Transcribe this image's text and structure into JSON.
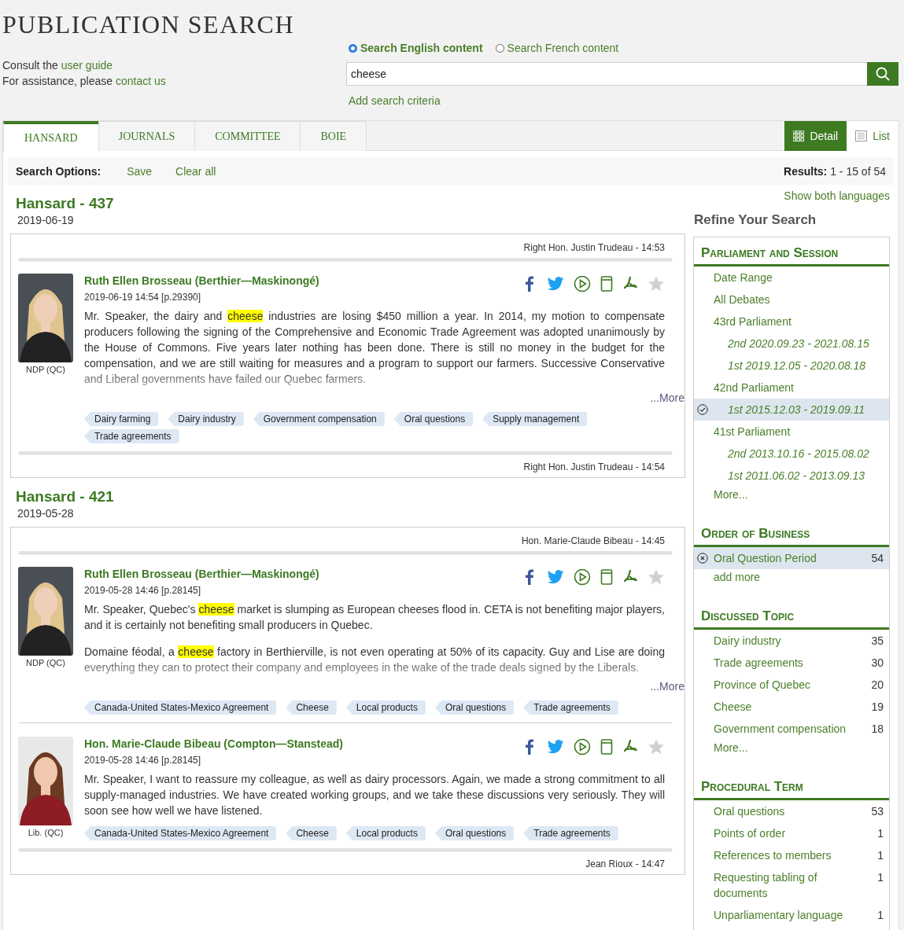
{
  "title": "PUBLICATION SEARCH",
  "help": [
    {
      "text": "Consult the ",
      "link": "user guide"
    },
    {
      "text": "For assistance, please ",
      "link": "contact us"
    }
  ],
  "language_options": [
    {
      "label": "Search English content",
      "selected": true
    },
    {
      "label": "Search French content",
      "selected": false
    }
  ],
  "search": {
    "value": "cheese"
  },
  "add_criteria": "Add search criteria",
  "tabs": [
    {
      "label": "HANSARD",
      "selected": true
    },
    {
      "label": "JOURNALS",
      "selected": false
    },
    {
      "label": "COMMITTEE",
      "selected": false
    },
    {
      "label": "BOIE",
      "selected": false
    }
  ],
  "views": [
    {
      "label": "Detail",
      "kind": "grid",
      "selected": true
    },
    {
      "label": "List",
      "kind": "list",
      "selected": false
    }
  ],
  "options_bar": {
    "label": "Search Options:",
    "actions": [
      "Save",
      "Clear all"
    ],
    "results_label": "Results:",
    "results": "1 - 15 of 54"
  },
  "groups": [
    {
      "title": "Hansard - 437",
      "date": "2019-06-19",
      "header": "Right Hon. Justin Trudeau - 14:53",
      "footer": "Right Hon. Justin Trudeau - 14:54",
      "interventions": [
        {
          "name": "Ruth Ellen Brosseau (Berthier—Maskinongé)",
          "date_ref": "2019-06-19 14:54 [p.29390]",
          "party": "NDP (QC)",
          "starred": false,
          "truncated": true,
          "more": "...More",
          "paragraphs": [
            [
              {
                "text": "Mr. Speaker, the dairy and ",
                "highlighted": false
              },
              {
                "text": "cheese",
                "highlighted": true
              },
              {
                "text": " industries are losing $450 million a year. In 2014, my motion to compensate producers following the signing of the Comprehensive and Economic Trade Agreement was adopted unanimously by the House of Commons. Five years later nothing has been done. There is still no money in the budget for the compensation, and we are still waiting for measures and a program to support our farmers. Successive Conservative and Liberal governments have failed our Quebec farmers.",
                "highlighted": false
              }
            ]
          ],
          "tags": [
            "Dairy farming",
            "Dairy industry",
            "Government compensation",
            "Oral questions",
            "Supply management",
            "Trade agreements"
          ]
        }
      ]
    },
    {
      "title": "Hansard - 421",
      "date": "2019-05-28",
      "header": "Hon. Marie-Claude Bibeau - 14:45",
      "footer": "Jean Rioux - 14:47",
      "interventions": [
        {
          "name": "Ruth Ellen Brosseau (Berthier—Maskinongé)",
          "date_ref": "2019-05-28 14:46 [p.28145]",
          "party": "NDP (QC)",
          "starred": false,
          "truncated": true,
          "more": "...More",
          "paragraphs": [
            [
              {
                "text": "Mr. Speaker, Quebec's ",
                "highlighted": false
              },
              {
                "text": "cheese",
                "highlighted": true
              },
              {
                "text": " market is slumping as European cheeses flood in. CETA is not benefiting major players, and it is certainly not benefiting small producers in Quebec.",
                "highlighted": false
              }
            ],
            [
              {
                "text": "Domaine féodal, a ",
                "highlighted": false
              },
              {
                "text": "cheese",
                "highlighted": true
              },
              {
                "text": " factory in Berthierville, is not even operating at 50% of its capacity. Guy and Lise are doing everything they can to protect their company and employees in the wake of the trade deals signed by the Liberals.",
                "highlighted": false
              }
            ]
          ],
          "tags": [
            "Canada-United States-Mexico Agreement",
            "Cheese",
            "Local products",
            "Oral questions",
            "Trade agreements"
          ]
        },
        {
          "name": "Hon. Marie-Claude Bibeau (Compton—Stanstead)",
          "date_ref": "2019-05-28 14:46 [p.28145]",
          "party": "Lib. (QC)",
          "starred": false,
          "truncated": false,
          "paragraphs": [
            [
              {
                "text": "Mr. Speaker, I want to reassure my colleague, as well as dairy processors. Again, we made a strong commitment to all supply-managed industries. We have created working groups, and we take these discussions very seriously. They will soon see how well we have listened.",
                "highlighted": false
              }
            ]
          ],
          "tags": [
            "Canada-United States-Mexico Agreement",
            "Cheese",
            "Local products",
            "Oral questions",
            "Trade agreements"
          ]
        }
      ]
    }
  ],
  "sidebar": {
    "show_both": "Show both languages",
    "heading": "Refine Your Search",
    "facets": [
      {
        "title": "Parliament and Session",
        "kind": "hierarchy",
        "more": "More...",
        "items": [
          {
            "label": "Date Range",
            "selected": false
          },
          {
            "label": "All Debates",
            "selected": false
          },
          {
            "label": "43rd Parliament",
            "selected": false,
            "children": [
              {
                "label": "2nd 2020.09.23 - 2021.08.15",
                "selected": false
              },
              {
                "label": "1st 2019.12.05 - 2020.08.18",
                "selected": false
              }
            ]
          },
          {
            "label": "42nd Parliament",
            "selected": false,
            "children": [
              {
                "label": "1st 2015.12.03 - 2019.09.11",
                "selected": true
              }
            ]
          },
          {
            "label": "41st Parliament",
            "selected": false,
            "children": [
              {
                "label": "2nd 2013.10.16 - 2015.08.02",
                "selected": false
              },
              {
                "label": "1st 2011.06.02 - 2013.09.13",
                "selected": false
              }
            ]
          }
        ]
      },
      {
        "title": "Order of Business",
        "kind": "filter",
        "more": "add more",
        "items": [
          {
            "label": "Oral Question Period",
            "count": "54",
            "selected": true
          }
        ]
      },
      {
        "title": "Discussed Topic",
        "more": "More...",
        "items": [
          {
            "label": "Dairy industry",
            "count": "35",
            "selected": false
          },
          {
            "label": "Trade agreements",
            "count": "30",
            "selected": false
          },
          {
            "label": "Province of Quebec",
            "count": "20",
            "selected": false
          },
          {
            "label": "Cheese",
            "count": "19",
            "selected": false
          },
          {
            "label": "Government compensation",
            "count": "18",
            "selected": false
          }
        ]
      },
      {
        "title": "Procedural Term",
        "items": [
          {
            "label": "Oral questions",
            "count": "53",
            "selected": false
          },
          {
            "label": "Points of order",
            "count": "1",
            "selected": false
          },
          {
            "label": "References to members",
            "count": "1",
            "selected": false
          },
          {
            "label": "Requesting tabling of documents",
            "count": "1",
            "selected": false
          },
          {
            "label": "Unparliamentary language",
            "count": "1",
            "selected": false
          }
        ]
      }
    ]
  }
}
